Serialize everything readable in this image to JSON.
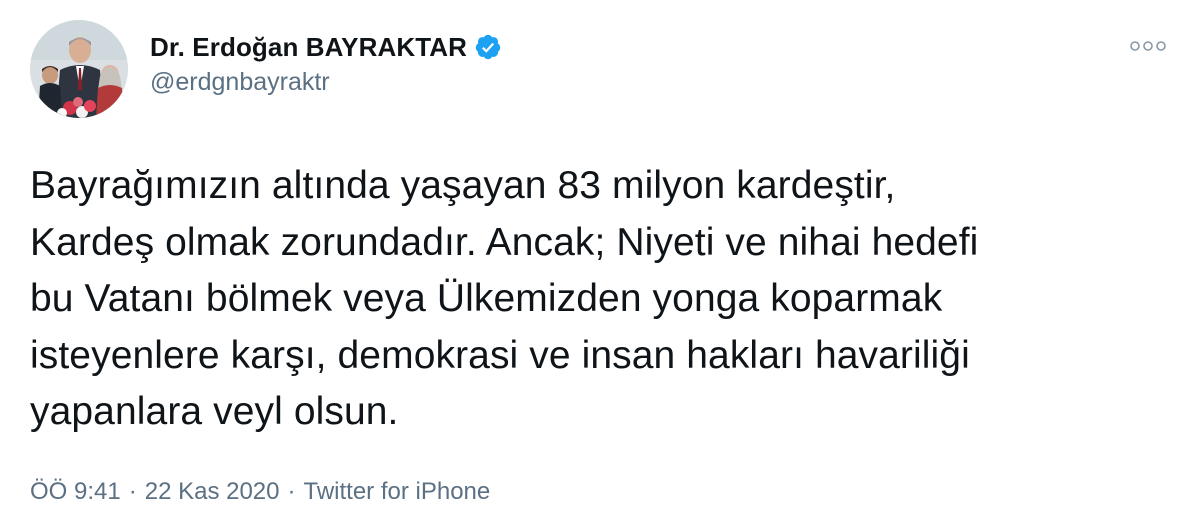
{
  "author": {
    "display_name": "Dr. Erdoğan BAYRAKTAR",
    "handle": "@erdgnbayraktr",
    "verified": true
  },
  "tweet": {
    "text": "Bayrağımızın altında yaşayan 83 milyon kardeştir,\nKardeş olmak zorundadır. Ancak; Niyeti ve nihai hedefi\nbu Vatanı bölmek veya Ülkemizden yonga koparmak\nisteyenlere karşı, demokrasi ve insan hakları havariliği\nyapanlara veyl olsun."
  },
  "meta": {
    "time": "ÖÖ 9:41",
    "separator": "·",
    "date": "22 Kas 2020",
    "source": "Twitter for iPhone"
  },
  "icons": {
    "verified": "verified-badge-icon",
    "more": "more-options-icon"
  },
  "colors": {
    "text": "#0f1419",
    "secondary": "#5b7083",
    "verified_blue": "#1da1f2"
  }
}
